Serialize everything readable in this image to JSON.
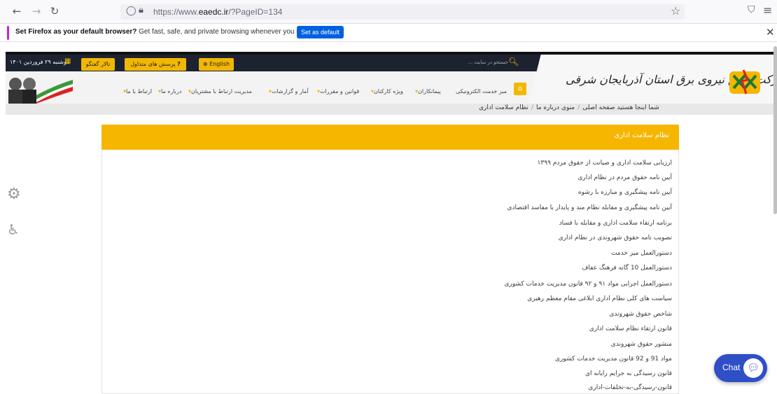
{
  "browser": {
    "url_prefix": "https://www.",
    "url_domain": "eaedc.ir",
    "url_rest": "/?PageID=134",
    "notification": {
      "bold": "Set Firefox as your default browser?",
      "text": " Get fast, safe, and private browsing whenever you use the web.",
      "button": "Set as default"
    }
  },
  "header": {
    "date": "دوشنبه ۲۹ فروردین ۱۴۰۱",
    "talar": "تالار گفتگو",
    "faq": "پرسش های متداول",
    "english": "English",
    "search_placeholder": "جستجو در سایت ...",
    "logo_text": "شرکت توزیع نیروی برق استان آذربایجان شرقی"
  },
  "menu": [
    "میز خدمت الکترونیکی",
    "پیمانکاران",
    "ویژه کارکنان",
    "قوانین و مقررات",
    "آمار و گزارشات",
    "مدیریت ارتباط با مشتریان",
    "درباره ما",
    "ارتباط با ما"
  ],
  "breadcrumb": {
    "lead": "شما اینجا هستید",
    "items": [
      "صفحه اصلی",
      "منوی درباره ما",
      "نظام سلامت اداری"
    ]
  },
  "panel": {
    "title": "نظام سلامت اداری",
    "links": [
      "ارزیابی سلامت اداری و صیانت از حقوق مردم ۱۳۹۹",
      "آیین نامه حقوق مردم در نظام اداری",
      "آیین نامه پیشگیری و مبارزه با رشوه",
      "آیین نامه پیشگیری و مقابله نظام مند و پایدار با مفاسد اقتصادی",
      "برنامه ارتقاء سلامت اداری و مقابله با فساد",
      "تصویب نامه حقوق شهروندی در نظام اداری",
      "دستورالعمل میز خدمت",
      "دستورالعمل 10 گانه فرهنگ عفاف",
      "دستورالعمل اجرایی مواد ۹۱ و ۹۲ قانون مدیریت خدمات کشوری",
      "سیاست های کلی نظام اداری ابلاغی مقام معظم رهبری",
      "شاخص حقوق شهروندی",
      "قانون ارتقاء نظام سلامت اداری",
      "منشور حقوق شهروندی",
      "مواد 91 و 92 قانون مدیریت خدمات کشوری",
      "قانون رسیدگی به جرایم رایانه ای",
      "قانون-رسیدگی-به-تخلفات-اداری"
    ]
  },
  "chat": {
    "label": "Chat"
  }
}
